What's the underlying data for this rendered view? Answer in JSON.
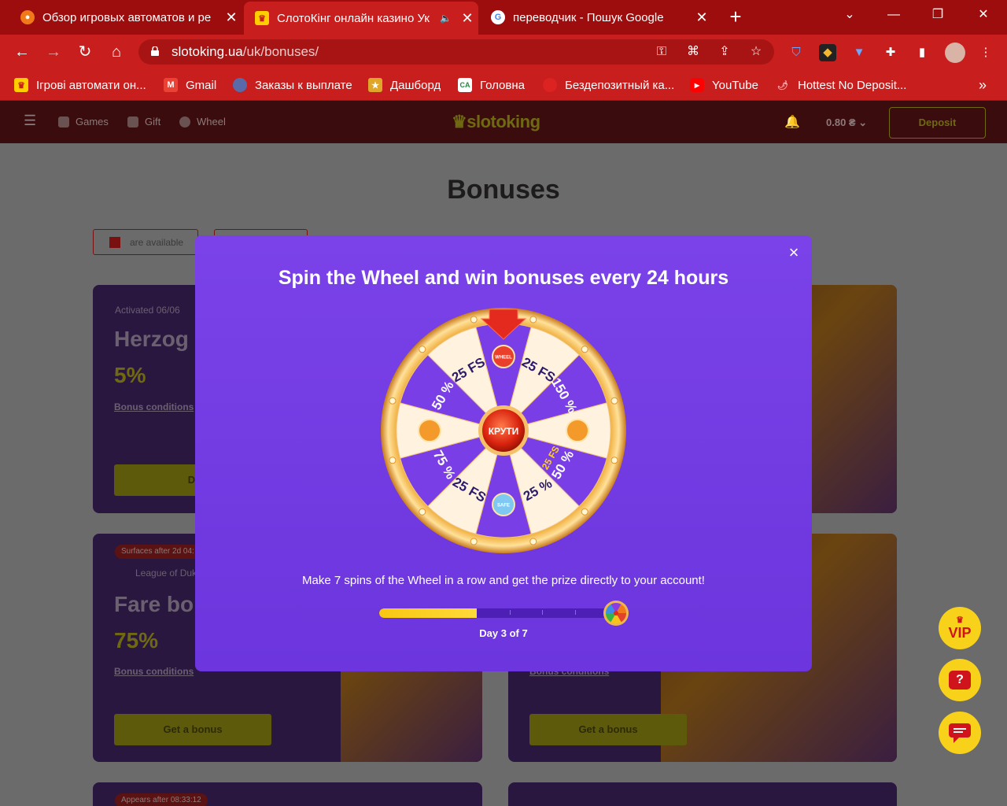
{
  "browser": {
    "tabs": [
      {
        "title": "Обзор игровых автоматов и ре",
        "active": false
      },
      {
        "title": "СлотоКінг онлайн казино Ук",
        "active": true
      },
      {
        "title": "переводчик - Пошук Google",
        "active": false
      }
    ],
    "url_host": "slotoking.ua",
    "url_path": "/uk/bonuses/",
    "bookmarks": [
      "Ігрові автомати он...",
      "Gmail",
      "Заказы к выплате",
      "Дашборд",
      "Головна",
      "Бездепозитный ка...",
      "YouTube",
      "Hottest No Deposit..."
    ],
    "more": "»"
  },
  "site": {
    "nav": {
      "games": "Games",
      "gift": "Gift",
      "wheel": "Wheel"
    },
    "logo": "slotoking",
    "balance": "0.80 ₴",
    "deposit": "Deposit",
    "page_title": "Bonuses",
    "filters": {
      "available": "are available"
    },
    "cards": [
      {
        "meta": "Activated 06/06",
        "title": "Herzog",
        "pct": "5%",
        "cond": "Bonus conditions",
        "btn": "Depo"
      },
      {
        "badge": "Surfaces after 2d 04:",
        "meta": "League of Duk",
        "title": "Fare bor",
        "pct": "75%",
        "cond": "Bonus conditions",
        "btn": "Get a bonus"
      },
      {
        "cond": "Bonus conditions",
        "btn": "Get a bonus"
      },
      {
        "badge": "Appears after 08:33:12"
      }
    ],
    "fabs": {
      "vip": "VIP",
      "help": "?",
      "chat": "chat"
    }
  },
  "modal": {
    "title": "Spin the Wheel and win bonuses every 24 hours",
    "close": "×",
    "spin_label": "КРУТИ",
    "segments": [
      "WHEEL",
      "25 FS",
      "150 %",
      "coin-icon",
      "50 % 25 FS",
      "25 %",
      "SAFE",
      "25 FS",
      "75 %",
      "coin-icon",
      "50 %",
      "25 FS"
    ],
    "text": "Make 7 spins of the Wheel in a row and get the prize directly to your account!",
    "progress": {
      "current": 3,
      "total": 7,
      "label": "Day 3 of 7"
    }
  }
}
